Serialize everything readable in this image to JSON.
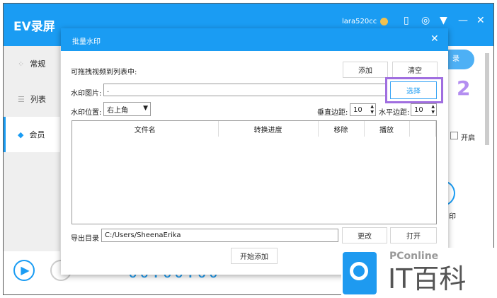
{
  "app": {
    "title": "EV录屏",
    "username": "lara520cc"
  },
  "sidebar": {
    "items": [
      {
        "label": "常规"
      },
      {
        "label": "列表"
      },
      {
        "label": "会员"
      }
    ]
  },
  "background": {
    "right_button": "录",
    "checkbox_label": "开启",
    "icon_label": "印",
    "timer": "00:00:00"
  },
  "dialog": {
    "title": "批量水印",
    "drag_hint": "可拖拽视频到列表中:",
    "add_label": "添加",
    "clear_label": "清空",
    "image_label": "水印图片:",
    "image_value": ".",
    "choose_label": "选择",
    "position_label": "水印位置:",
    "position_value": "右上角",
    "vmargin_label": "垂直边距:",
    "vmargin_value": "10",
    "hmargin_label": "水平边距:",
    "hmargin_value": "10",
    "table": {
      "columns": [
        "文件名",
        "转换进度",
        "移除",
        "播放"
      ]
    },
    "export_label": "导出目录",
    "export_value": "C:/Users/SheenaErika",
    "change_label": "更改",
    "open_label": "打开",
    "start_label": "开始添加"
  },
  "annotation": {
    "step": "2"
  },
  "watermark": {
    "brand": "PConline",
    "name": "IT百科"
  },
  "colors": {
    "accent": "#1a9cf3",
    "highlight": "#a06ee0"
  }
}
